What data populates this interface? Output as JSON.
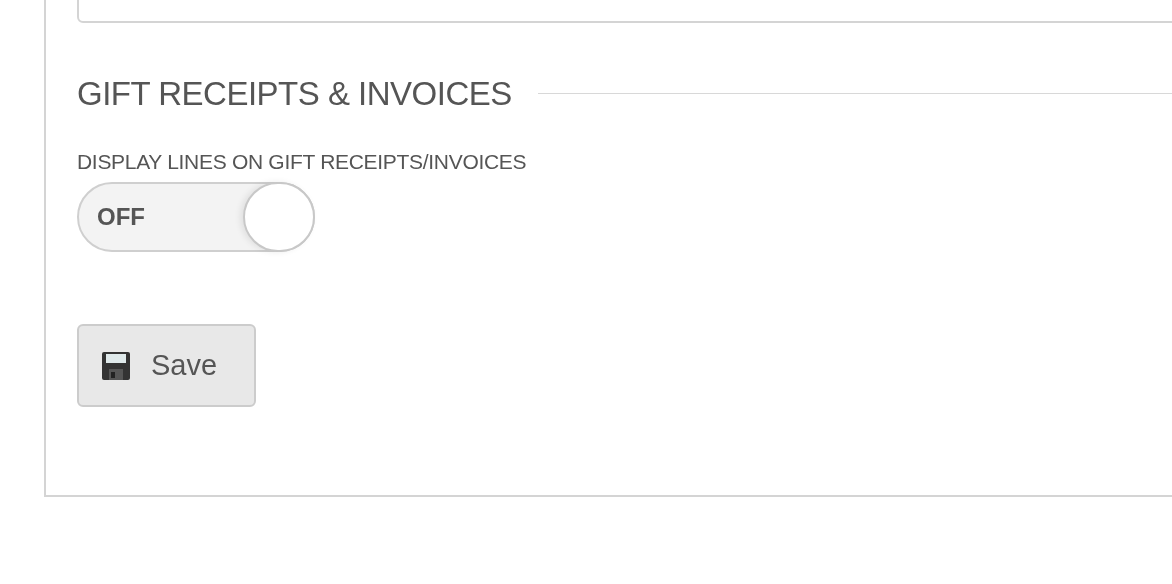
{
  "section": {
    "title": "GIFT RECEIPTS & INVOICES"
  },
  "setting": {
    "label": "DISPLAY LINES ON GIFT RECEIPTS/INVOICES",
    "toggle": {
      "text": "OFF",
      "on": false
    }
  },
  "buttons": [
    {
      "label": "Save"
    }
  ]
}
